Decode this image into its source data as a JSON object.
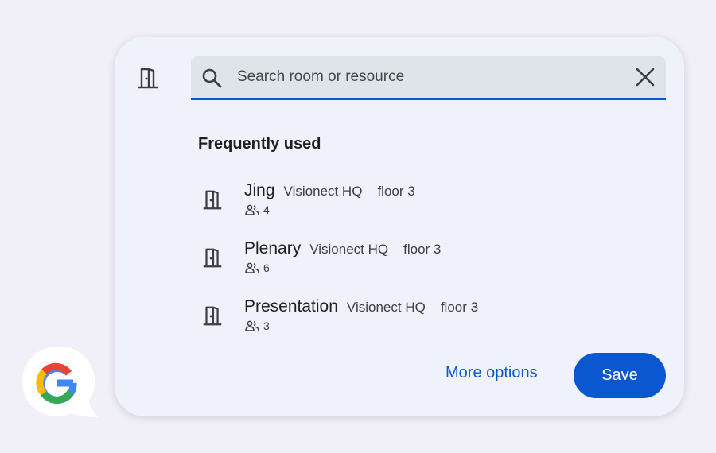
{
  "search": {
    "placeholder": "Search room or resource",
    "value": ""
  },
  "section": {
    "title": "Frequently used"
  },
  "rooms": [
    {
      "name": "Jing",
      "building": "Visionect HQ",
      "floor": "floor 3",
      "capacity": "4"
    },
    {
      "name": "Plenary",
      "building": "Visionect HQ",
      "floor": "floor 3",
      "capacity": "6"
    },
    {
      "name": "Presentation",
      "building": "Visionect HQ",
      "floor": "floor 3",
      "capacity": "3"
    }
  ],
  "footer": {
    "more_options_label": "More options",
    "save_label": "Save"
  },
  "icons": {
    "header": "door-icon",
    "search": "search-icon",
    "clear": "close-icon",
    "room": "door-icon",
    "capacity": "people-icon",
    "badge": "google-logo-icon"
  },
  "colors": {
    "accent": "#0b57d0",
    "card_bg": "#eff2fa",
    "search_bg": "#dfe3ea",
    "page_bg": "#f1f0f8"
  }
}
